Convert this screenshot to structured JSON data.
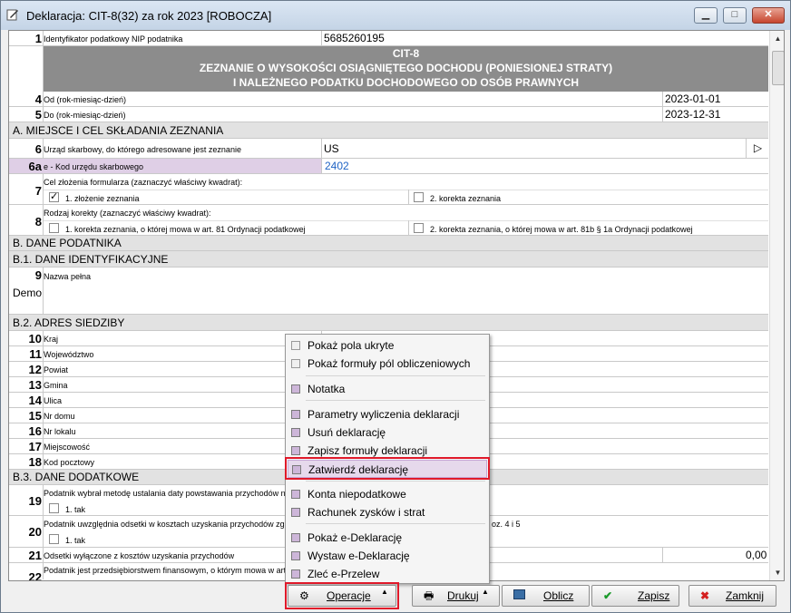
{
  "window": {
    "title": "Deklaracja: CIT-8(32) za rok 2023  [ROBOCZA]",
    "min_glyph": "▁",
    "max_glyph": "□",
    "close_glyph": "✕"
  },
  "form": {
    "header": {
      "line1": "CIT-8",
      "line2": "ZEZNANIE O WYSOKOŚCI OSIĄGNIĘTEGO DOCHODU (PONIESIONEJ STRATY)",
      "line3": "I NALEŻNEGO PODATKU DOCHODOWEGO OD OSÓB PRAWNYCH"
    },
    "row1": {
      "num": "1",
      "label": "Identyfikator podatkowy NIP podatnika",
      "value": "5685260195"
    },
    "row4": {
      "num": "4",
      "label": "Od (rok-miesiąc-dzień)",
      "value": "2023-01-01"
    },
    "row5": {
      "num": "5",
      "label": "Do (rok-miesiąc-dzień)",
      "value": "2023-12-31"
    },
    "sectionA": "A. MIEJSCE I CEL SKŁADANIA ZEZNANIA",
    "row6": {
      "num": "6",
      "label": "Urząd skarbowy, do którego adresowane jest zeznanie",
      "value": "US",
      "btn": "▷"
    },
    "row6a": {
      "num": "6a",
      "label": "e - Kod urzędu skarbowego",
      "value": "2402"
    },
    "row7": {
      "num": "7",
      "label": "Cel złożenia formularza (zaznaczyć właściwy kwadrat):",
      "opt1": "1. złożenie zeznania",
      "opt2": "2. korekta zeznania",
      "check": "✓"
    },
    "row8": {
      "num": "8",
      "label": "Rodzaj korekty (zaznaczyć właściwy kwadrat):",
      "opt1": "1.  korekta zeznania, o której mowa w art. 81 Ordynacji podatkowej",
      "opt2": "2.  korekta zeznania, o której mowa w art. 81b § 1a Ordynacji podatkowej"
    },
    "sectionB": "B. DANE PODATNIKA",
    "sectionB1": "B.1. DANE IDENTYFIKACYJNE",
    "row9": {
      "num": "9",
      "label": "Nazwa pełna",
      "value": "Demo"
    },
    "sectionB2": "B.2. ADRES SIEDZIBY",
    "address": [
      {
        "num": "10",
        "label": "Kraj"
      },
      {
        "num": "11",
        "label": "Województwo"
      },
      {
        "num": "12",
        "label": "Powiat"
      },
      {
        "num": "13",
        "label": "Gmina"
      },
      {
        "num": "14",
        "label": "Ulica"
      },
      {
        "num": "15",
        "label": "Nr domu"
      },
      {
        "num": "16",
        "label": "Nr lokalu"
      },
      {
        "num": "17",
        "label": "Miejscowość"
      },
      {
        "num": "18",
        "label": "Kod pocztowy"
      }
    ],
    "sectionB3": "B.3. DANE DODATKOWE",
    "row19": {
      "num": "19",
      "label": "Podatnik wybrał metodę ustalania daty powstawania przychodów na",
      "opt": "1. tak"
    },
    "row20": {
      "num": "20",
      "label": "Podatnik uwzględnia odsetki w kosztach uzyskania przychodów zgod",
      "label_tail": "oz. 4 i 5",
      "opt": "1. tak"
    },
    "row21": {
      "num": "21",
      "label": "Odsetki wyłączone z kosztów uzyskania przychodów",
      "value": "0,00"
    },
    "row22": {
      "num": "22",
      "label": "Podatnik jest przedsiębiorstwem finansowym, o którym mowa  w art"
    }
  },
  "menu": {
    "items": [
      "Pokaż pola ukryte",
      "Pokaż formuły pól obliczeniowych",
      "Notatka",
      "Parametry wyliczenia deklaracji",
      "Usuń deklarację",
      "Zapisz formuły deklaracji",
      "Zatwierdź deklarację",
      "Konta niepodatkowe",
      "Rachunek zysków i strat",
      "Pokaż e-Deklarację",
      "Wystaw e-Deklarację",
      "Zleć e-Przelew"
    ]
  },
  "buttons": {
    "operacje": "Operacje",
    "drukuj": "Drukuj",
    "oblicz": "Oblicz",
    "zapisz": "Zapisz",
    "zamknij": "Zamknij",
    "dropdown_arrow": "▲"
  },
  "colors": {
    "accent_purple": "#e6d9ec",
    "highlight_red": "#e0192a",
    "header_gray": "#8c8c8c",
    "link_blue": "#1f63c4"
  },
  "icons": {
    "scroll_up": "▲",
    "scroll_down": "▼"
  }
}
